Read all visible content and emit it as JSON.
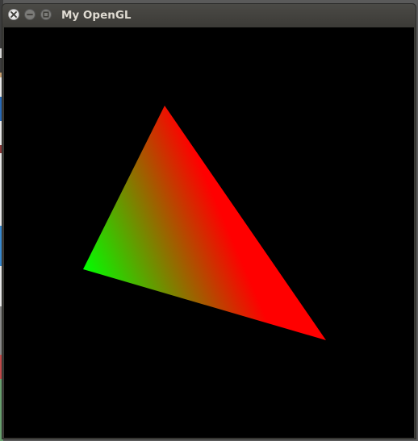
{
  "window": {
    "title": "My OpenGL",
    "buttons": {
      "close_icon": "close-icon",
      "minimize_icon": "minimize-icon",
      "maximize_icon": "maximize-icon"
    }
  },
  "scene": {
    "background_color": "#000000",
    "vertex_colors": {
      "top": "#ff0000",
      "left": "#00ff00",
      "right": "#ff0000"
    }
  }
}
